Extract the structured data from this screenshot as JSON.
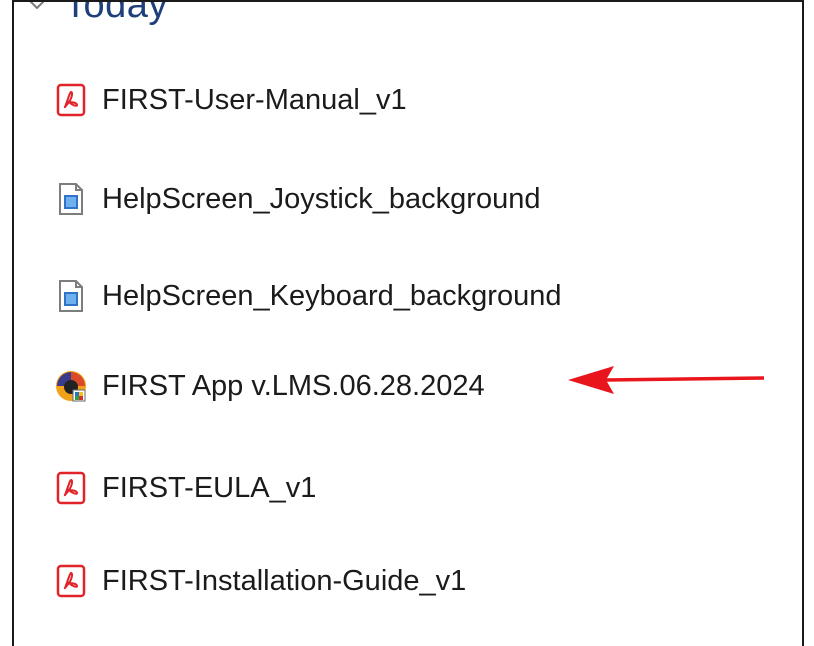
{
  "group": {
    "title": "Today",
    "expanded": true
  },
  "items": [
    {
      "label": "FIRST-User-Manual_v1",
      "icon": "pdf-file-icon"
    },
    {
      "label": "HelpScreen_Joystick_background",
      "icon": "image-file-icon"
    },
    {
      "label": "HelpScreen_Keyboard_background",
      "icon": "image-file-icon"
    },
    {
      "label": "FIRST App v.LMS.06.28.2024",
      "icon": "app-shortcut-icon"
    },
    {
      "label": "FIRST-EULA_v1",
      "icon": "pdf-file-icon"
    },
    {
      "label": "FIRST-Installation-Guide_v1",
      "icon": "pdf-file-icon"
    }
  ],
  "colors": {
    "group_title": "#1e3f7a",
    "pdf_red": "#e0242a",
    "annotation_arrow": "#e8161c"
  }
}
